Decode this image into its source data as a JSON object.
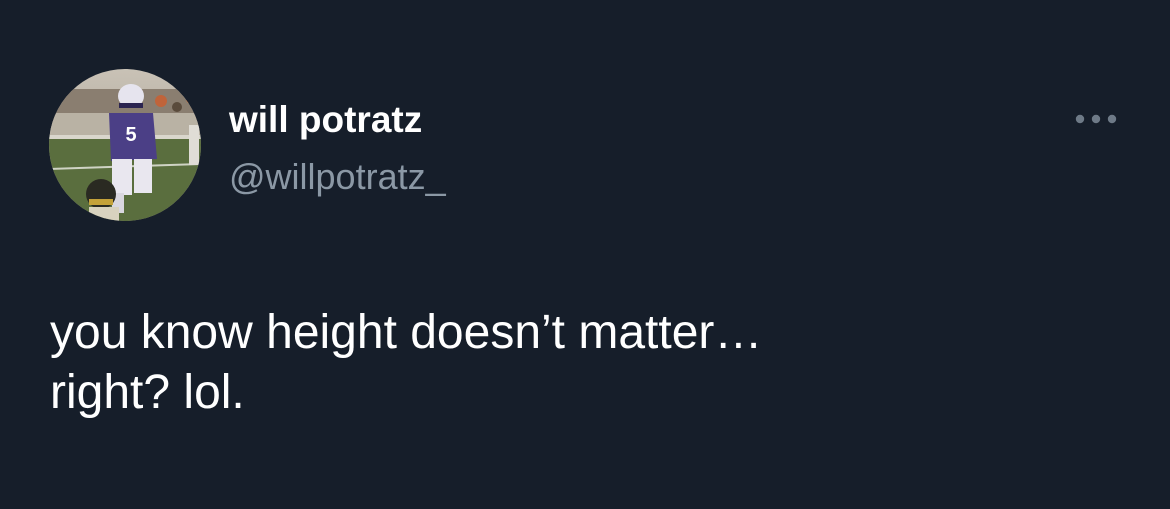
{
  "tweet": {
    "author": {
      "display_name": "will potratz",
      "handle": "@willpotratz_",
      "avatar_icon": "profile-photo-football-player"
    },
    "menu_icon": "more-options-icon",
    "text_lines": [
      "you know height doesn’t matter…",
      "right? lol."
    ]
  },
  "colors": {
    "background": "#161e2a",
    "primary_text": "#ffffff",
    "secondary_text": "#8b98a5"
  }
}
